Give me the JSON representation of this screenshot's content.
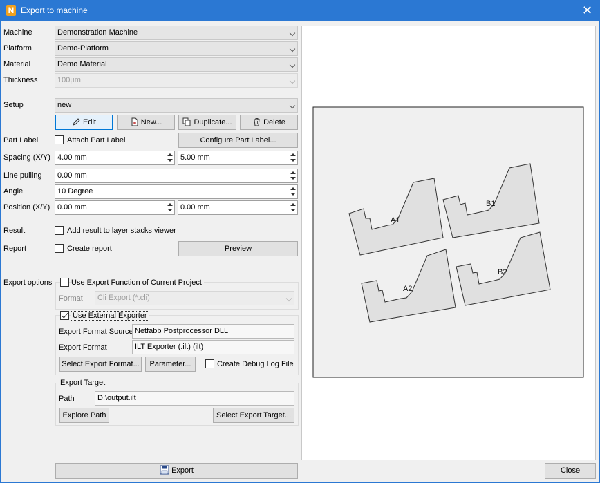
{
  "window": {
    "title": "Export to machine",
    "app_icon": "N",
    "close_glyph": "✕"
  },
  "form": {
    "machine": {
      "label": "Machine",
      "value": "Demonstration Machine"
    },
    "platform": {
      "label": "Platform",
      "value": "Demo-Platform"
    },
    "material": {
      "label": "Material",
      "value": "Demo Material"
    },
    "thickness": {
      "label": "Thickness",
      "value": "100µm"
    },
    "setup": {
      "label": "Setup",
      "value": "new"
    },
    "setup_buttons": {
      "edit": "Edit",
      "new": "New...",
      "duplicate": "Duplicate...",
      "delete": "Delete"
    },
    "part_label": {
      "label": "Part Label",
      "checkbox": "Attach Part Label",
      "checked": false,
      "configure": "Configure Part Label..."
    },
    "spacing": {
      "label": "Spacing (X/Y)",
      "x": "4.00 mm",
      "y": "5.00 mm"
    },
    "line_pulling": {
      "label": "Line pulling",
      "value": "0.00 mm"
    },
    "angle": {
      "label": "Angle",
      "value": "10 Degree"
    },
    "position": {
      "label": "Position (X/Y)",
      "x": "0.00 mm",
      "y": "0.00 mm"
    },
    "result": {
      "label": "Result",
      "checkbox": "Add result to layer stacks viewer",
      "checked": false
    },
    "report": {
      "label": "Report",
      "checkbox": "Create report",
      "checked": false,
      "preview": "Preview"
    }
  },
  "export_options": {
    "label": "Export options",
    "use_project": {
      "label": "Use Export Function of Current Project",
      "checked": false
    },
    "format_label": "Format",
    "format_value": "Cli Export (*.cli)",
    "use_external": {
      "label": "Use External Exporter",
      "checked": true
    },
    "source_label": "Export Format Source",
    "source_value": "Netfabb Postprocessor DLL",
    "export_format_label": "Export Format",
    "export_format_value": "ILT Exporter (.ilt) (ilt)",
    "select_format_btn": "Select Export Format...",
    "parameter_btn": "Parameter...",
    "debug_log": {
      "label": "Create Debug Log File",
      "checked": false
    },
    "target": {
      "group_label": "Export Target",
      "path_label": "Path",
      "path_value": "D:\\output.ilt",
      "explore_btn": "Explore Path",
      "select_target_btn": "Select Export Target..."
    }
  },
  "footer": {
    "export_btn": "Export",
    "close_btn": "Close"
  },
  "preview": {
    "parts": [
      {
        "label": "A1"
      },
      {
        "label": "B1"
      },
      {
        "label": "A2"
      },
      {
        "label": "B2"
      }
    ]
  },
  "colors": {
    "titlebar": "#2b78d3",
    "accent": "#0078d7",
    "part_fill": "#e0e0e0"
  }
}
